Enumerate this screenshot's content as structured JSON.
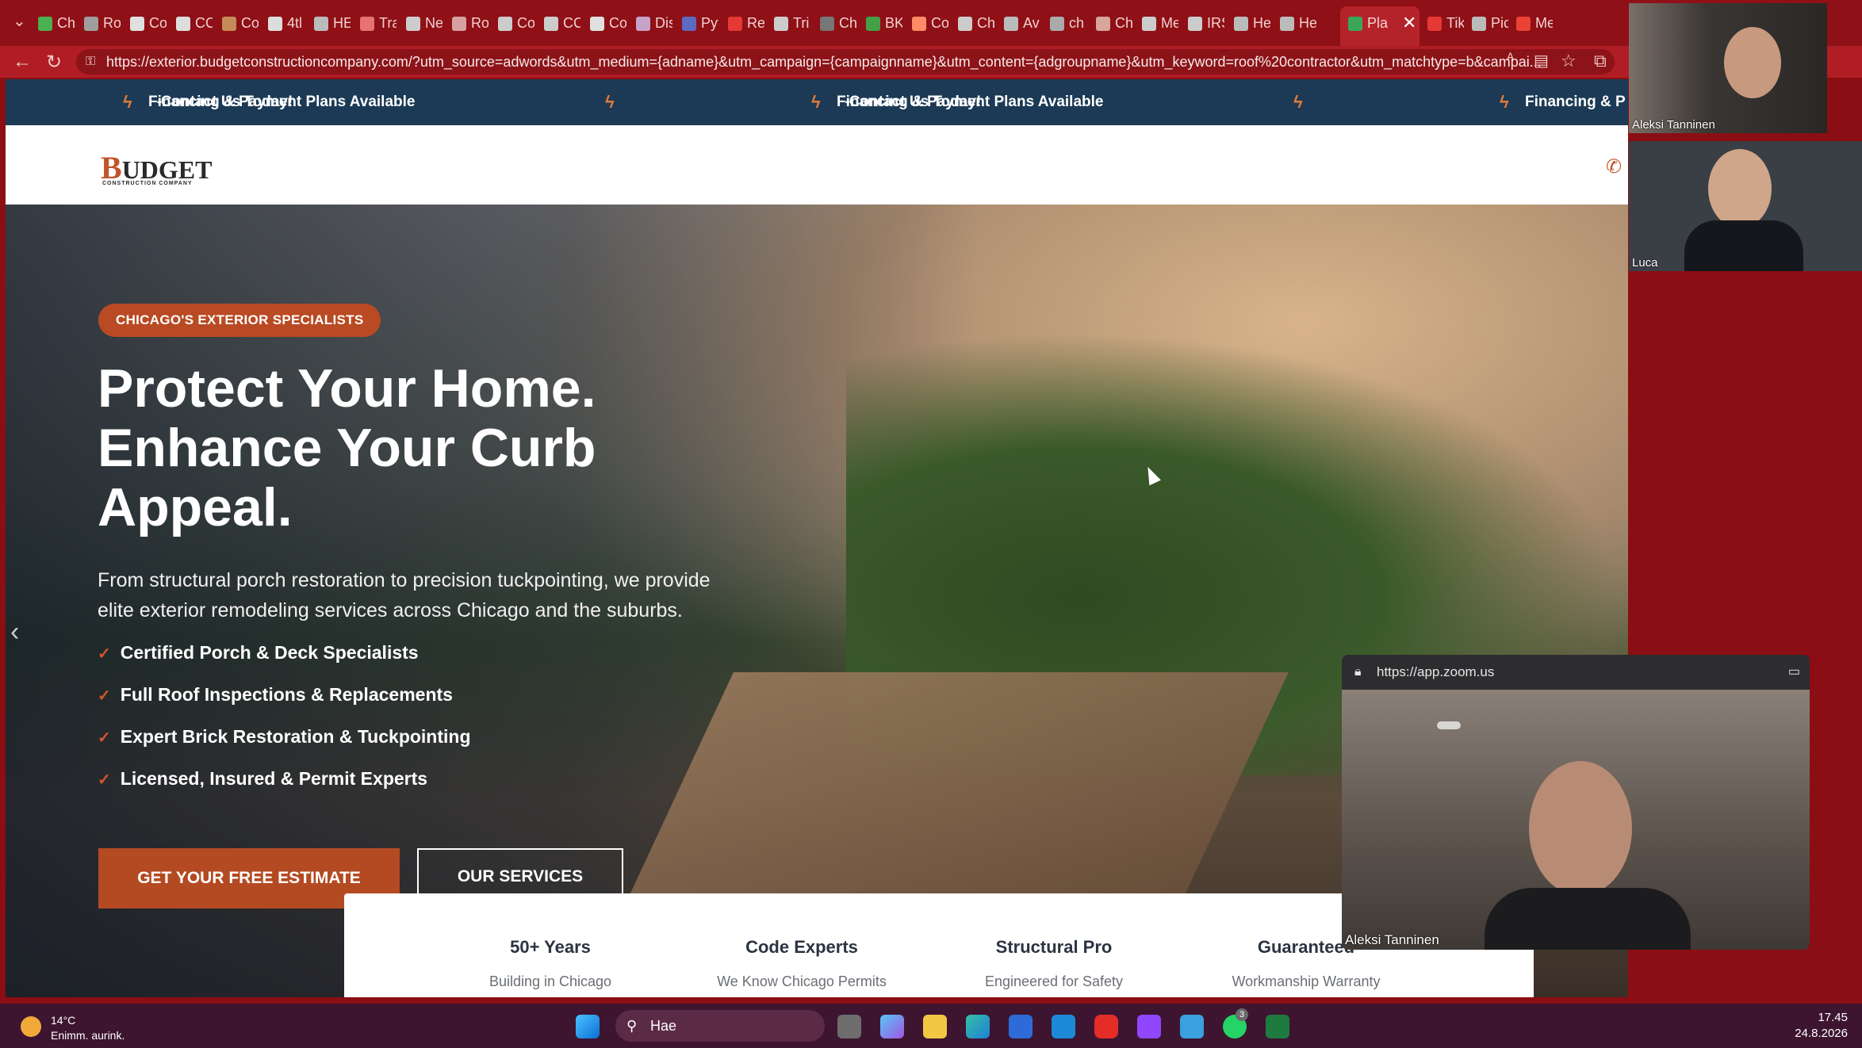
{
  "browser": {
    "tabs": [
      "Ch",
      "Ro",
      "Co",
      "CC",
      "Co",
      "4tl",
      "HE",
      "Tra",
      "Ne",
      "Ro",
      "Co",
      "CC",
      "Co",
      "Dis",
      "Pyt",
      "Re",
      "Tri",
      "Ch",
      "BK",
      "Co",
      "Ch",
      "Av",
      "ch",
      "Ch",
      "Me",
      "IRS",
      "He",
      "He",
      "Pla",
      "Tik",
      "Pic",
      "Me"
    ],
    "url": "https://exterior.budgetconstructioncompany.com/?utm_source=adwords&utm_medium={adname}&utm_campaign={campaignname}&utm_content={adgroupname}&utm_keyword=roof%20contractor&utm_matchtype=b&campai..."
  },
  "promo": {
    "text1": "Financing & Payment Plans Available",
    "sep": "-",
    "text2": "Contact Us Today!",
    "partial": "Financing & P"
  },
  "logo": {
    "first": "B",
    "rest": "UDGET",
    "sub": "CONSTRUCTION COMPANY"
  },
  "hero": {
    "badge": "CHICAGO'S EXTERIOR SPECIALISTS",
    "headline_line1": "Protect Your Home.",
    "headline_line2": "Enhance Your Curb",
    "headline_line3": "Appeal.",
    "lede": "From structural porch restoration to precision tuckpointing, we provide elite exterior remodeling services across Chicago and the suburbs.",
    "features": [
      "Certified Porch & Deck Specialists",
      "Full Roof Inspections & Replacements",
      "Expert Brick Restoration & Tuckpointing",
      "Licensed, Insured & Permit Experts"
    ],
    "cta_primary": "GET YOUR FREE ESTIMATE",
    "cta_secondary": "OUR SERVICES"
  },
  "stats": [
    {
      "title": "50+ Years",
      "sub": "Building in Chicago"
    },
    {
      "title": "Code Experts",
      "sub": "We Know Chicago Permits"
    },
    {
      "title": "Structural Pro",
      "sub": "Engineered for Safety"
    },
    {
      "title": "Guaranteed",
      "sub": "Workmanship Warranty"
    }
  ],
  "zoom": {
    "participant1": "Aleksi Tanninen",
    "participant2": "Luca",
    "pip_url": "https://app.zoom.us",
    "pip_name": "Aleksi Tanninen"
  },
  "taskbar": {
    "temp": "14°C",
    "weather": "Enimm. aurink.",
    "search": "Hae",
    "time": "17.45",
    "date": "24.8.2026",
    "badge_count": "3"
  },
  "colors": {
    "accent": "#b44a22",
    "promo_bg": "#1c3a55",
    "browser": "#8f1016"
  }
}
